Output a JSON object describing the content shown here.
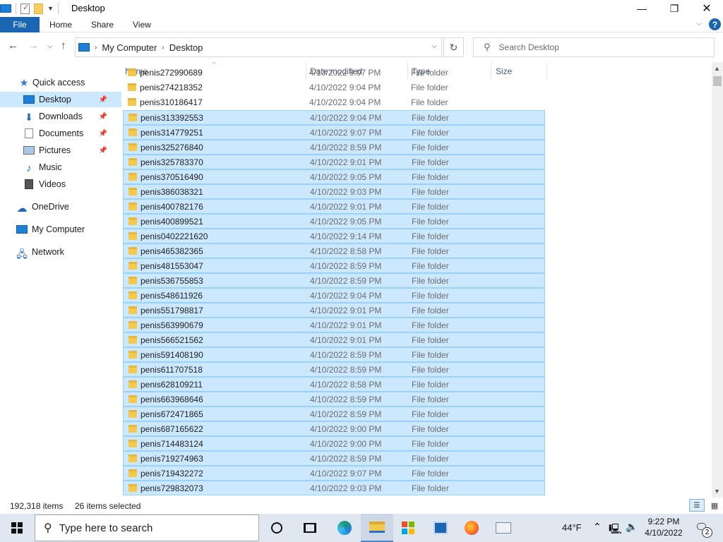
{
  "titlebar": {
    "title": "Desktop",
    "minimize": "—",
    "maximize": "❐",
    "close": "✕"
  },
  "ribbon": {
    "tabs": [
      "File",
      "Home",
      "Share",
      "View"
    ],
    "help": "?"
  },
  "address": {
    "crumbs": [
      "My Computer",
      "Desktop"
    ],
    "search_placeholder": "Search Desktop"
  },
  "navpane": {
    "items": [
      {
        "label": "Quick access",
        "icon": "star-icon"
      },
      {
        "label": "Desktop",
        "icon": "desktop-icon",
        "pinned": true,
        "active": true
      },
      {
        "label": "Downloads",
        "icon": "download-icon",
        "pinned": true
      },
      {
        "label": "Documents",
        "icon": "documents-icon",
        "pinned": true
      },
      {
        "label": "Pictures",
        "icon": "pictures-icon",
        "pinned": true
      },
      {
        "label": "Music",
        "icon": "music-icon"
      },
      {
        "label": "Videos",
        "icon": "videos-icon"
      },
      {
        "label": "OneDrive",
        "icon": "cloud-icon"
      },
      {
        "label": "My Computer",
        "icon": "computer-icon"
      },
      {
        "label": "Network",
        "icon": "network-icon"
      }
    ]
  },
  "columns": {
    "name": "Name",
    "date": "Date modified",
    "type": "Type",
    "size": "Size"
  },
  "files": [
    {
      "name": "penis272990689",
      "date": "4/10/2022 9:07 PM",
      "type": "File folder",
      "selected": false
    },
    {
      "name": "penis274218352",
      "date": "4/10/2022 9:04 PM",
      "type": "File folder",
      "selected": false
    },
    {
      "name": "penis310186417",
      "date": "4/10/2022 9:04 PM",
      "type": "File folder",
      "selected": false
    },
    {
      "name": "penis313392553",
      "date": "4/10/2022 9:04 PM",
      "type": "File folder",
      "selected": true
    },
    {
      "name": "penis314779251",
      "date": "4/10/2022 9:07 PM",
      "type": "File folder",
      "selected": true
    },
    {
      "name": "penis325276840",
      "date": "4/10/2022 8:59 PM",
      "type": "File folder",
      "selected": true
    },
    {
      "name": "penis325783370",
      "date": "4/10/2022 9:01 PM",
      "type": "File folder",
      "selected": true
    },
    {
      "name": "penis370516490",
      "date": "4/10/2022 9:05 PM",
      "type": "File folder",
      "selected": true
    },
    {
      "name": "penis386038321",
      "date": "4/10/2022 9:03 PM",
      "type": "File folder",
      "selected": true
    },
    {
      "name": "penis400782176",
      "date": "4/10/2022 9:01 PM",
      "type": "File folder",
      "selected": true
    },
    {
      "name": "penis400899521",
      "date": "4/10/2022 9:05 PM",
      "type": "File folder",
      "selected": true
    },
    {
      "name": "penis0402221620",
      "date": "4/10/2022 9:14 PM",
      "type": "File folder",
      "selected": true
    },
    {
      "name": "penis465382365",
      "date": "4/10/2022 8:58 PM",
      "type": "File folder",
      "selected": true
    },
    {
      "name": "penis481553047",
      "date": "4/10/2022 8:59 PM",
      "type": "File folder",
      "selected": true
    },
    {
      "name": "penis536755853",
      "date": "4/10/2022 8:59 PM",
      "type": "File folder",
      "selected": true
    },
    {
      "name": "penis548611926",
      "date": "4/10/2022 9:04 PM",
      "type": "File folder",
      "selected": true
    },
    {
      "name": "penis551798817",
      "date": "4/10/2022 9:01 PM",
      "type": "File folder",
      "selected": true
    },
    {
      "name": "penis563990679",
      "date": "4/10/2022 9:01 PM",
      "type": "File folder",
      "selected": true
    },
    {
      "name": "penis566521562",
      "date": "4/10/2022 9:01 PM",
      "type": "File folder",
      "selected": true
    },
    {
      "name": "penis591408190",
      "date": "4/10/2022 8:59 PM",
      "type": "File folder",
      "selected": true
    },
    {
      "name": "penis611707518",
      "date": "4/10/2022 8:59 PM",
      "type": "File folder",
      "selected": true
    },
    {
      "name": "penis628109211",
      "date": "4/10/2022 8:58 PM",
      "type": "File folder",
      "selected": true
    },
    {
      "name": "penis663968646",
      "date": "4/10/2022 8:59 PM",
      "type": "File folder",
      "selected": true
    },
    {
      "name": "penis672471865",
      "date": "4/10/2022 8:59 PM",
      "type": "File folder",
      "selected": true
    },
    {
      "name": "penis687165622",
      "date": "4/10/2022 9:00 PM",
      "type": "File folder",
      "selected": true
    },
    {
      "name": "penis714483124",
      "date": "4/10/2022 9:00 PM",
      "type": "File folder",
      "selected": true
    },
    {
      "name": "penis719274963",
      "date": "4/10/2022 8:59 PM",
      "type": "File folder",
      "selected": true
    },
    {
      "name": "penis719432272",
      "date": "4/10/2022 9:07 PM",
      "type": "File folder",
      "selected": true
    },
    {
      "name": "penis729832073",
      "date": "4/10/2022 9:03 PM",
      "type": "File folder",
      "selected": true
    }
  ],
  "status": {
    "item_count": "192,318 items",
    "selected_count": "26 items selected"
  },
  "taskbar": {
    "search_placeholder": "Type here to search",
    "temperature": "44°F",
    "time": "9:22 PM",
    "date": "4/10/2022",
    "notification_count": "2"
  },
  "colors": {
    "accent": "#1a66b3",
    "selection": "#cce8ff",
    "selection_border": "#99d1ff"
  }
}
